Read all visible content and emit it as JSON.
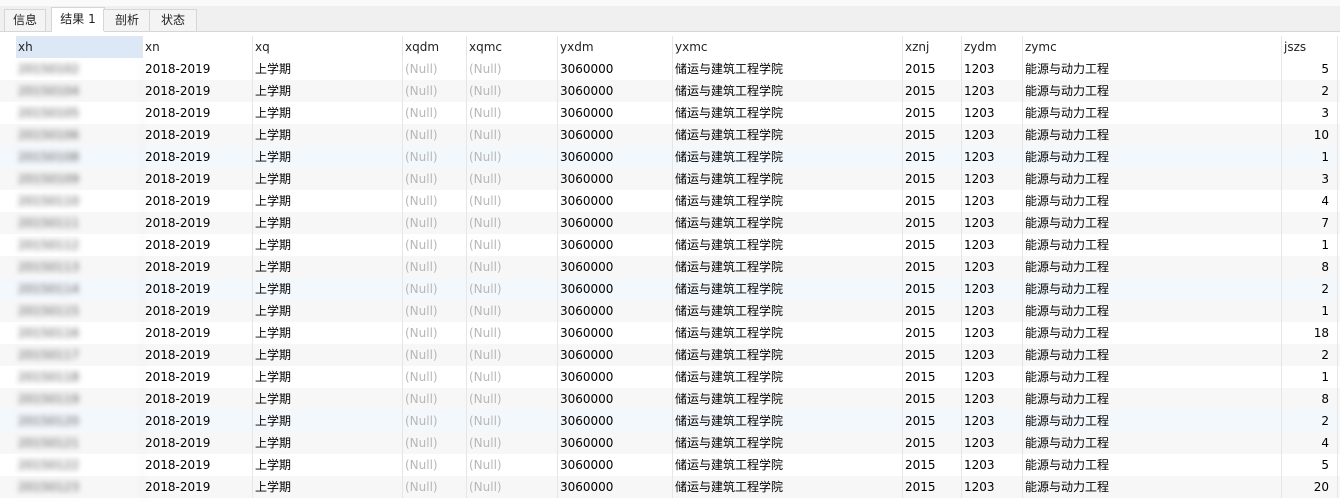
{
  "tabs": [
    {
      "label": "信息"
    },
    {
      "label": "结果 1"
    },
    {
      "label": "剖析"
    },
    {
      "label": "状态"
    }
  ],
  "grid": {
    "columns": [
      "xh",
      "xn",
      "xq",
      "xqdm",
      "xqmc",
      "yxdm",
      "yxmc",
      "xznj",
      "zydm",
      "zymc",
      "jszs"
    ],
    "rows": [
      {
        "xh": "20150102",
        "xn": "2018-2019",
        "xq": "上学期",
        "xqdm": "(Null)",
        "xqmc": "(Null)",
        "yxdm": "3060000",
        "yxmc": "储运与建筑工程学院",
        "xznj": "2015",
        "zydm": "1203",
        "zymc": "能源与动力工程",
        "jszs": "5"
      },
      {
        "xh": "20150104",
        "xn": "2018-2019",
        "xq": "上学期",
        "xqdm": "(Null)",
        "xqmc": "(Null)",
        "yxdm": "3060000",
        "yxmc": "储运与建筑工程学院",
        "xznj": "2015",
        "zydm": "1203",
        "zymc": "能源与动力工程",
        "jszs": "2"
      },
      {
        "xh": "20150105",
        "xn": "2018-2019",
        "xq": "上学期",
        "xqdm": "(Null)",
        "xqmc": "(Null)",
        "yxdm": "3060000",
        "yxmc": "储运与建筑工程学院",
        "xznj": "2015",
        "zydm": "1203",
        "zymc": "能源与动力工程",
        "jszs": "3"
      },
      {
        "xh": "20150106",
        "xn": "2018-2019",
        "xq": "上学期",
        "xqdm": "(Null)",
        "xqmc": "(Null)",
        "yxdm": "3060000",
        "yxmc": "储运与建筑工程学院",
        "xznj": "2015",
        "zydm": "1203",
        "zymc": "能源与动力工程",
        "jszs": "10"
      },
      {
        "xh": "20150108",
        "xn": "2018-2019",
        "xq": "上学期",
        "xqdm": "(Null)",
        "xqmc": "(Null)",
        "yxdm": "3060000",
        "yxmc": "储运与建筑工程学院",
        "xznj": "2015",
        "zydm": "1203",
        "zymc": "能源与动力工程",
        "jszs": "1"
      },
      {
        "xh": "20150109",
        "xn": "2018-2019",
        "xq": "上学期",
        "xqdm": "(Null)",
        "xqmc": "(Null)",
        "yxdm": "3060000",
        "yxmc": "储运与建筑工程学院",
        "xznj": "2015",
        "zydm": "1203",
        "zymc": "能源与动力工程",
        "jszs": "3"
      },
      {
        "xh": "20150110",
        "xn": "2018-2019",
        "xq": "上学期",
        "xqdm": "(Null)",
        "xqmc": "(Null)",
        "yxdm": "3060000",
        "yxmc": "储运与建筑工程学院",
        "xznj": "2015",
        "zydm": "1203",
        "zymc": "能源与动力工程",
        "jszs": "4"
      },
      {
        "xh": "20150111",
        "xn": "2018-2019",
        "xq": "上学期",
        "xqdm": "(Null)",
        "xqmc": "(Null)",
        "yxdm": "3060000",
        "yxmc": "储运与建筑工程学院",
        "xznj": "2015",
        "zydm": "1203",
        "zymc": "能源与动力工程",
        "jszs": "7"
      },
      {
        "xh": "20150112",
        "xn": "2018-2019",
        "xq": "上学期",
        "xqdm": "(Null)",
        "xqmc": "(Null)",
        "yxdm": "3060000",
        "yxmc": "储运与建筑工程学院",
        "xznj": "2015",
        "zydm": "1203",
        "zymc": "能源与动力工程",
        "jszs": "1"
      },
      {
        "xh": "20150113",
        "xn": "2018-2019",
        "xq": "上学期",
        "xqdm": "(Null)",
        "xqmc": "(Null)",
        "yxdm": "3060000",
        "yxmc": "储运与建筑工程学院",
        "xznj": "2015",
        "zydm": "1203",
        "zymc": "能源与动力工程",
        "jszs": "8"
      },
      {
        "xh": "20150114",
        "xn": "2018-2019",
        "xq": "上学期",
        "xqdm": "(Null)",
        "xqmc": "(Null)",
        "yxdm": "3060000",
        "yxmc": "储运与建筑工程学院",
        "xznj": "2015",
        "zydm": "1203",
        "zymc": "能源与动力工程",
        "jszs": "2"
      },
      {
        "xh": "20150115",
        "xn": "2018-2019",
        "xq": "上学期",
        "xqdm": "(Null)",
        "xqmc": "(Null)",
        "yxdm": "3060000",
        "yxmc": "储运与建筑工程学院",
        "xznj": "2015",
        "zydm": "1203",
        "zymc": "能源与动力工程",
        "jszs": "1"
      },
      {
        "xh": "20150116",
        "xn": "2018-2019",
        "xq": "上学期",
        "xqdm": "(Null)",
        "xqmc": "(Null)",
        "yxdm": "3060000",
        "yxmc": "储运与建筑工程学院",
        "xznj": "2015",
        "zydm": "1203",
        "zymc": "能源与动力工程",
        "jszs": "18"
      },
      {
        "xh": "20150117",
        "xn": "2018-2019",
        "xq": "上学期",
        "xqdm": "(Null)",
        "xqmc": "(Null)",
        "yxdm": "3060000",
        "yxmc": "储运与建筑工程学院",
        "xznj": "2015",
        "zydm": "1203",
        "zymc": "能源与动力工程",
        "jszs": "2"
      },
      {
        "xh": "20150118",
        "xn": "2018-2019",
        "xq": "上学期",
        "xqdm": "(Null)",
        "xqmc": "(Null)",
        "yxdm": "3060000",
        "yxmc": "储运与建筑工程学院",
        "xznj": "2015",
        "zydm": "1203",
        "zymc": "能源与动力工程",
        "jszs": "1"
      },
      {
        "xh": "20150119",
        "xn": "2018-2019",
        "xq": "上学期",
        "xqdm": "(Null)",
        "xqmc": "(Null)",
        "yxdm": "3060000",
        "yxmc": "储运与建筑工程学院",
        "xznj": "2015",
        "zydm": "1203",
        "zymc": "能源与动力工程",
        "jszs": "8"
      },
      {
        "xh": "20150120",
        "xn": "2018-2019",
        "xq": "上学期",
        "xqdm": "(Null)",
        "xqmc": "(Null)",
        "yxdm": "3060000",
        "yxmc": "储运与建筑工程学院",
        "xznj": "2015",
        "zydm": "1203",
        "zymc": "能源与动力工程",
        "jszs": "2"
      },
      {
        "xh": "20150121",
        "xn": "2018-2019",
        "xq": "上学期",
        "xqdm": "(Null)",
        "xqmc": "(Null)",
        "yxdm": "3060000",
        "yxmc": "储运与建筑工程学院",
        "xznj": "2015",
        "zydm": "1203",
        "zymc": "能源与动力工程",
        "jszs": "4"
      },
      {
        "xh": "20150122",
        "xn": "2018-2019",
        "xq": "上学期",
        "xqdm": "(Null)",
        "xqmc": "(Null)",
        "yxdm": "3060000",
        "yxmc": "储运与建筑工程学院",
        "xznj": "2015",
        "zydm": "1203",
        "zymc": "能源与动力工程",
        "jszs": "5"
      },
      {
        "xh": "20150123",
        "xn": "2018-2019",
        "xq": "上学期",
        "xqdm": "(Null)",
        "xqmc": "(Null)",
        "yxdm": "3060000",
        "yxmc": "储运与建筑工程学院",
        "xznj": "2015",
        "zydm": "1203",
        "zymc": "能源与动力工程",
        "jszs": "20"
      }
    ]
  }
}
